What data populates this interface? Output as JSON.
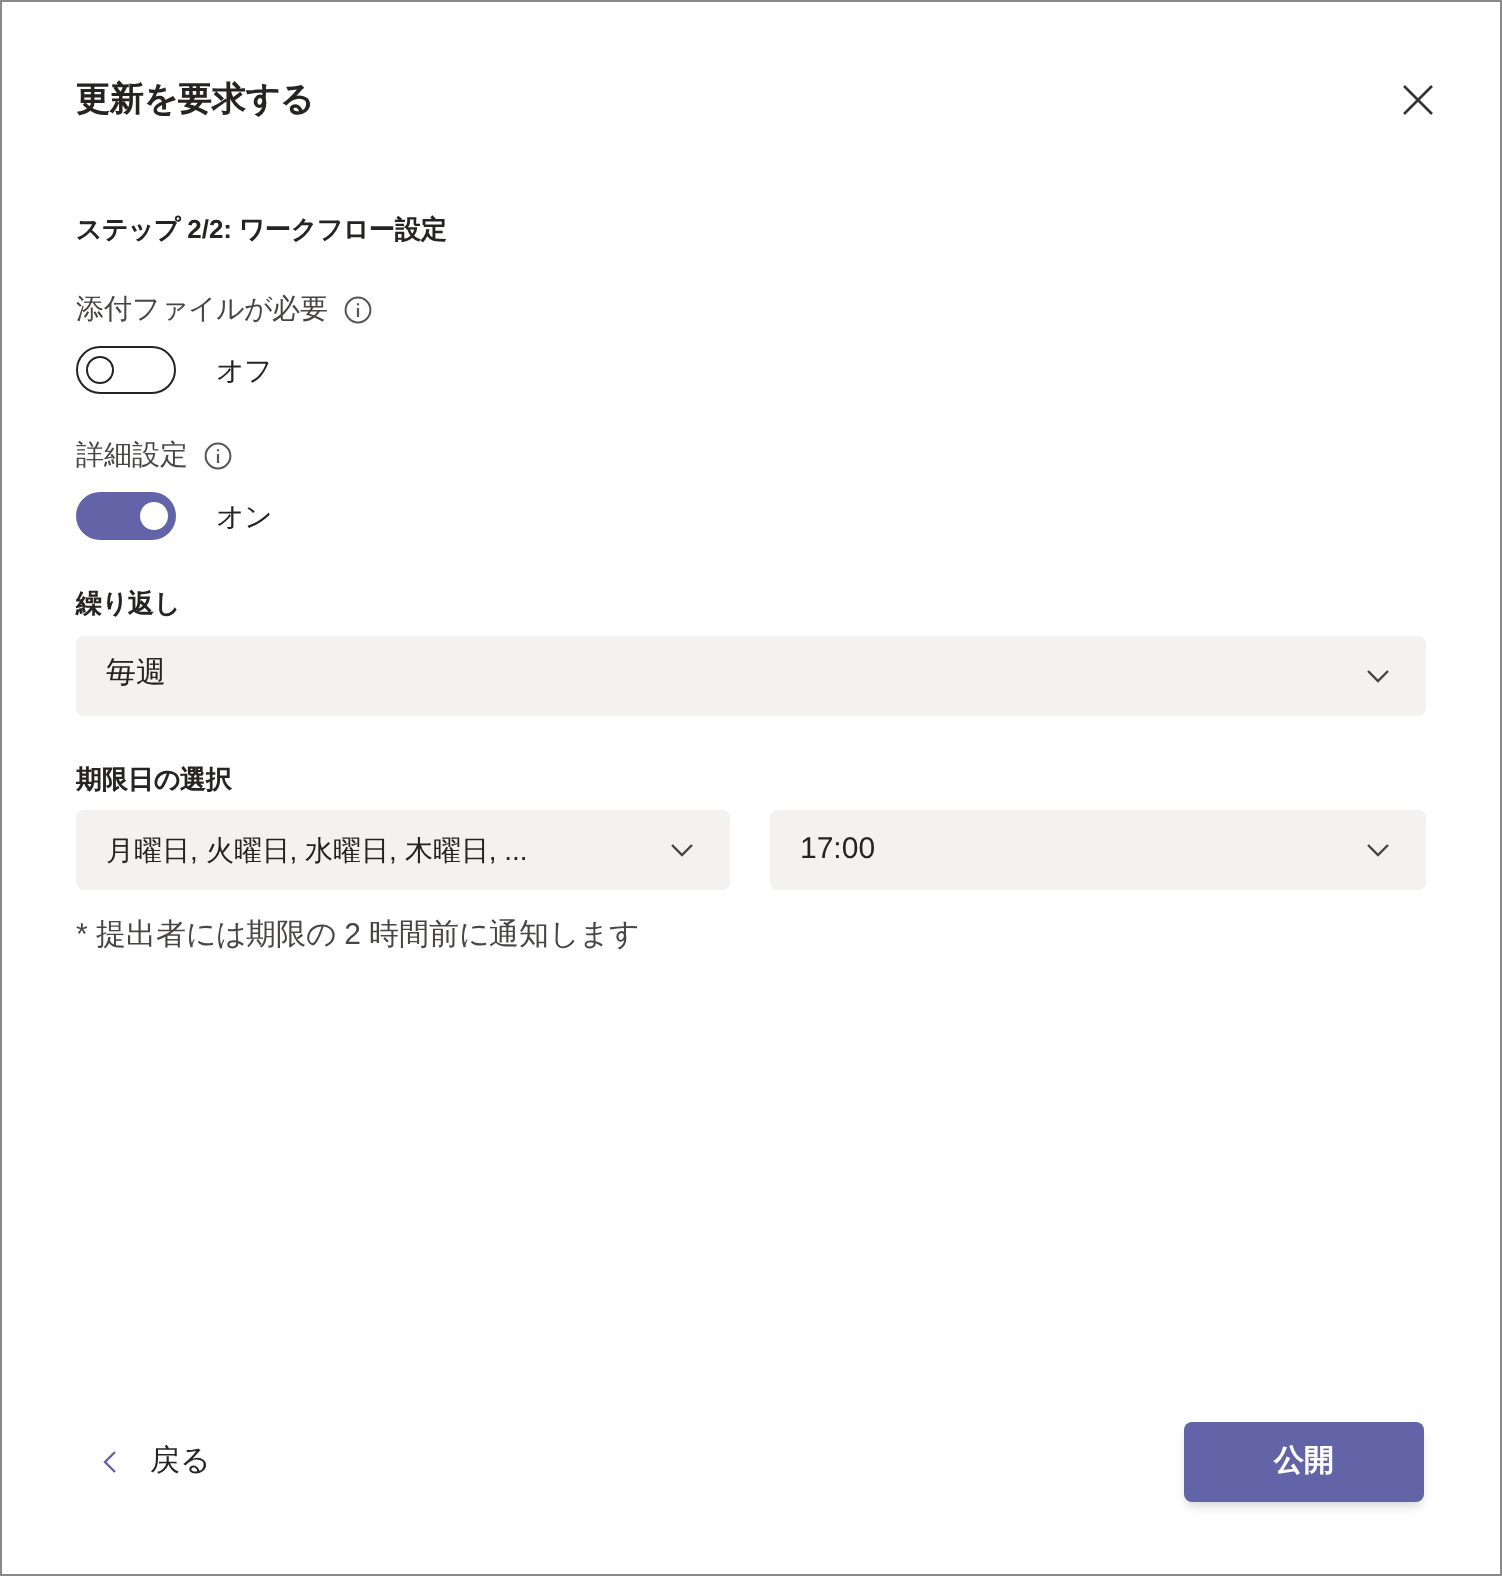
{
  "dialog": {
    "title": "更新を要求する",
    "step": "ステップ 2/2: ワークフロー設定"
  },
  "toggles": [
    {
      "label": "添付ファイルが必要",
      "on": false,
      "state_text": "オフ"
    },
    {
      "label": "詳細設定",
      "on": true,
      "state_text": "オン"
    }
  ],
  "repeat": {
    "label": "繰り返し",
    "value": "毎週"
  },
  "due": {
    "label": "期限日の選択",
    "days": "月曜日, 火曜日, 水曜日, 木曜日, ...",
    "time": "17:00",
    "note": "* 提出者には期限の 2 時間前に通知します"
  },
  "footer": {
    "back": "戻る",
    "publish": "公開"
  }
}
